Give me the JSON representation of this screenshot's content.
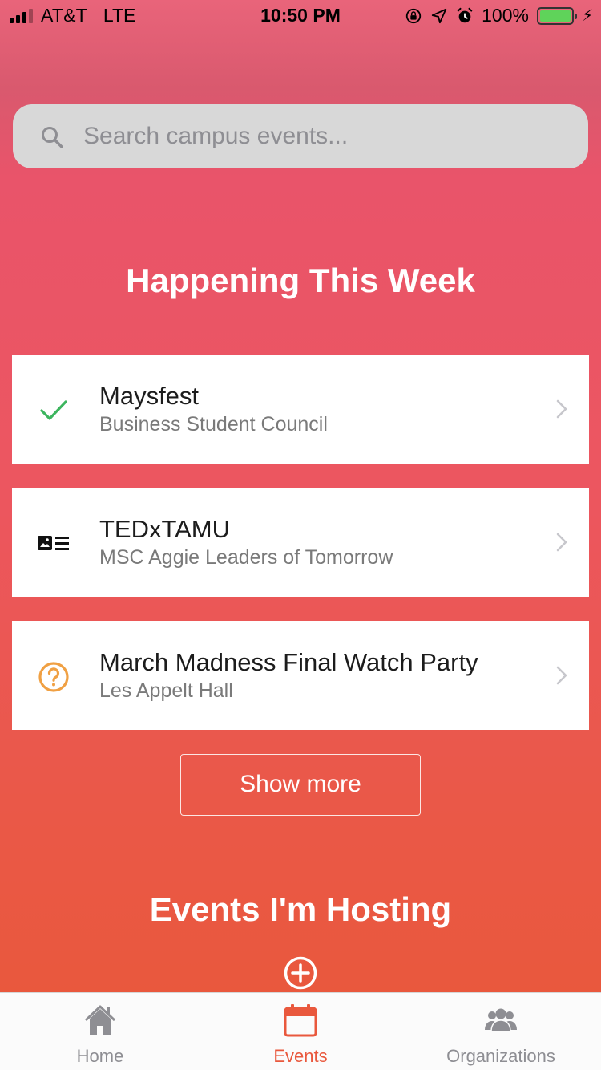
{
  "status_bar": {
    "carrier": "AT&T",
    "network": "LTE",
    "time": "10:50 PM",
    "battery_percent": "100%",
    "battery_level": 1.0
  },
  "search": {
    "placeholder": "Search campus events..."
  },
  "sections": {
    "week_title": "Happening This Week",
    "hosting_title": "Events I'm Hosting"
  },
  "events": [
    {
      "title": "Maysfest",
      "subtitle": "Business Student Council",
      "icon": "checkmark-icon",
      "icon_color": "#3cb55e"
    },
    {
      "title": "TEDxTAMU",
      "subtitle": "MSC Aggie Leaders of Tomorrow",
      "icon": "article-icon",
      "icon_color": "#111111"
    },
    {
      "title": "March Madness Final Watch Party",
      "subtitle": "Les Appelt Hall",
      "icon": "question-circle-icon",
      "icon_color": "#f0a043"
    }
  ],
  "show_more_label": "Show more",
  "tabs": [
    {
      "label": "Home",
      "icon": "home-icon",
      "active": false
    },
    {
      "label": "Events",
      "icon": "calendar-icon",
      "active": true
    },
    {
      "label": "Organizations",
      "icon": "people-icon",
      "active": false
    }
  ],
  "colors": {
    "accent": "#e9583d",
    "gradient_top": "#e9647a",
    "gradient_bottom": "#e9583d",
    "tab_inactive": "#8e8e93"
  }
}
